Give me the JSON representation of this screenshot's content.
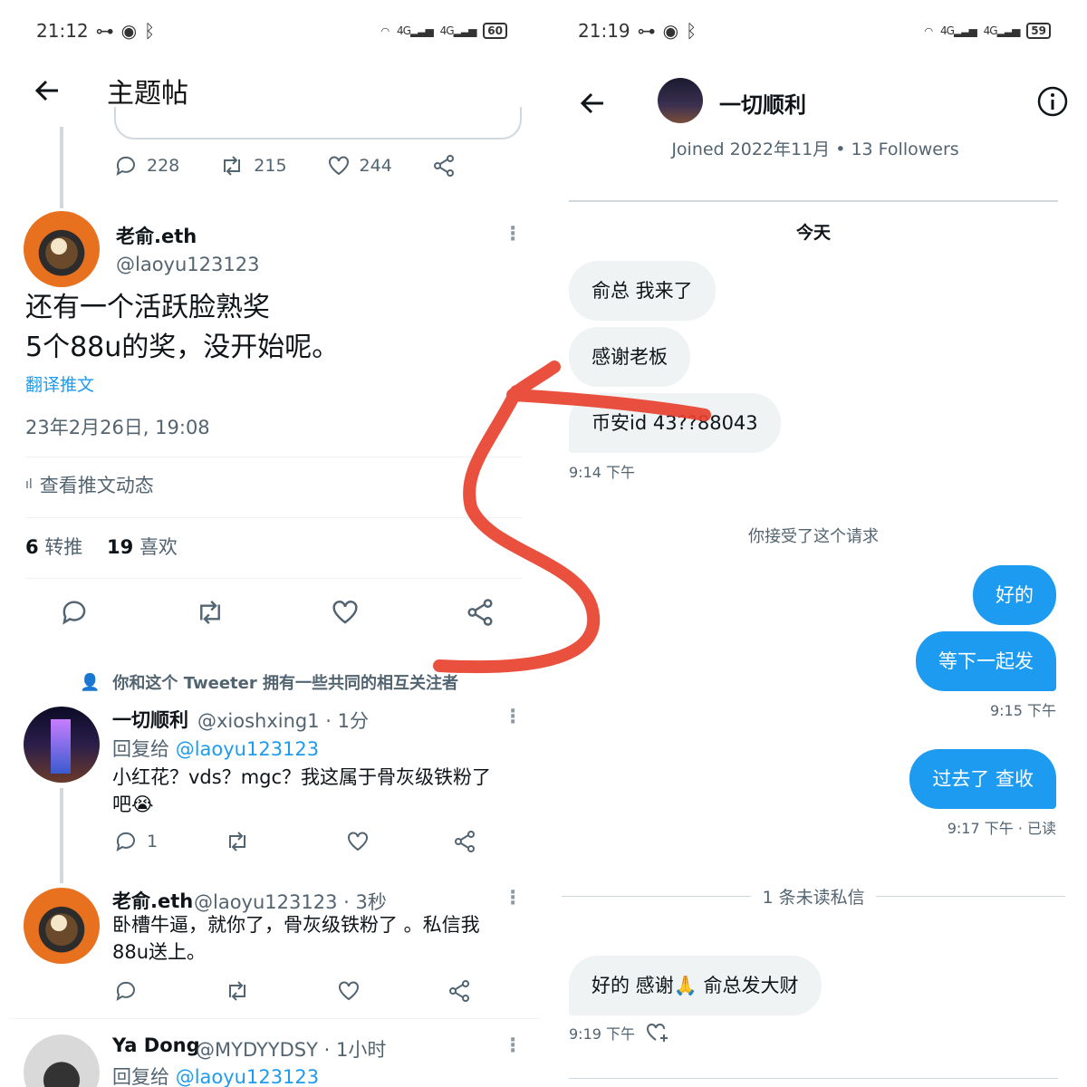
{
  "left": {
    "status": {
      "time": "21:12",
      "battery": "60",
      "signal": "4G"
    },
    "header": {
      "title": "主题帖"
    },
    "prev_actions": {
      "replies": "228",
      "retweets": "215",
      "likes": "244"
    },
    "main_tweet": {
      "name": "老俞.eth",
      "handle": "@laoyu123123",
      "line1": "还有一个活跃脸熟奖",
      "line2": "5个88u的奖，没开始呢。",
      "translate": "翻译推文",
      "timestamp": "23年2月26日, 19:08",
      "analytics": "查看推文动态",
      "retweet_count": "6",
      "retweet_label": "转推",
      "like_count": "19",
      "like_label": "喜欢"
    },
    "mutual_note": "你和这个 Tweeter 拥有一些共同的相互关注者",
    "replies": [
      {
        "name": "一切顺利",
        "meta": "@xioshxing1 · 1分",
        "reply_prefix": "回复给 ",
        "reply_handle": "@laoyu123123",
        "line1": "小红花？vds？mgc？我这属于骨灰级铁粉了",
        "line2": "吧😭",
        "reply_count": "1"
      },
      {
        "name": "老俞.eth",
        "meta": "@laoyu123123 · 3秒",
        "line1": "卧槽牛逼，就你了，骨灰级铁粉了 。私信我",
        "line2": "88u送上。"
      },
      {
        "name": "Ya Dong",
        "meta": "@MYDYYDSY · 1小时",
        "reply_prefix": "回复给 ",
        "reply_handle": "@laoyu123123"
      }
    ]
  },
  "right": {
    "status": {
      "time": "21:19",
      "battery": "59",
      "signal": "4G"
    },
    "header": {
      "name": "一切顺利",
      "joined": "Joined 2022年11月 • 13 Followers"
    },
    "day_label": "今天",
    "messages_in": [
      {
        "text": "俞总 我来了"
      },
      {
        "text": "感谢老板"
      },
      {
        "text": "币安id 43??88043"
      }
    ],
    "time_1": "9:14 下午",
    "system_note": "你接受了这个请求",
    "messages_out": [
      {
        "text": "好的"
      },
      {
        "text": "等下一起发"
      }
    ],
    "time_2": "9:15 下午",
    "message_out_3": "过去了 查收",
    "time_3": "9:17 下午 · 已读",
    "unread_label": "1 条未读私信",
    "final_in": "好的 感谢🙏 俞总发大财",
    "time_4": "9:19 下午"
  },
  "colors": {
    "accent": "#1d9bf0",
    "muted": "#536471",
    "bubble_in": "#eff3f4",
    "scribble": "#e8412e"
  }
}
